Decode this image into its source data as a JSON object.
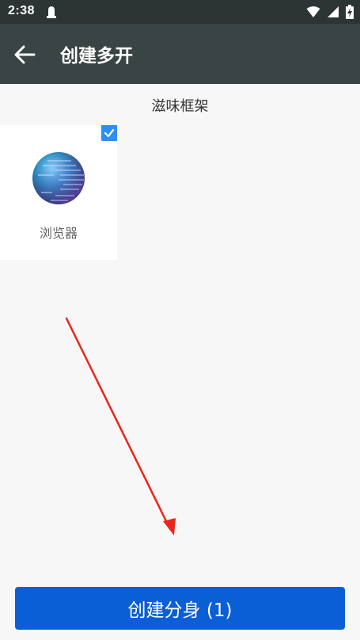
{
  "status_bar": {
    "time": "2:38"
  },
  "app_bar": {
    "title": "创建多开"
  },
  "content": {
    "framework_title": "滋味框架",
    "apps": [
      {
        "label": "浏览器",
        "icon": "globe-icon",
        "selected": true
      }
    ]
  },
  "footer": {
    "create_button_label": "创建分身 (1)"
  },
  "colors": {
    "status_bar_bg": "#2d3434",
    "app_bar_bg": "#3b4444",
    "page_bg": "#f7f7f7",
    "button_bg": "#0a5fd6",
    "check_badge": "#2f8ef5",
    "annotation_arrow": "#e8261c"
  }
}
